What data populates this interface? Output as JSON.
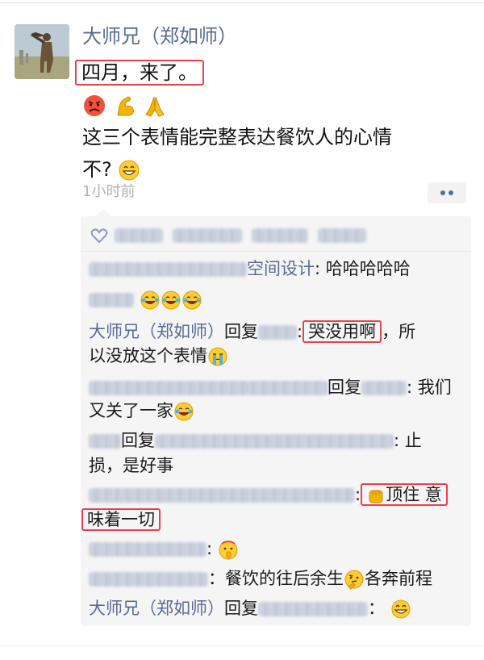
{
  "post": {
    "author": "大师兄（郑如师）",
    "text_line1": "四月，来了。",
    "text_line3": "这三个表情能完整表达餐饮人的心情",
    "text_line4": "不?",
    "time": "1小时前",
    "emojis": [
      "angry-face-icon",
      "flexed-biceps-icon",
      "folded-hands-icon"
    ]
  },
  "comments": [
    {
      "id": 1,
      "reply_to_name": "空间设计",
      "colon": ":",
      "text": "哈哈哈哈哈"
    },
    {
      "id": 2,
      "text": ""
    },
    {
      "id": 3,
      "author": "大师兄（郑如师）",
      "reply_word": "回复",
      "colon": ":",
      "text_hl": "哭没用啊",
      "text_rest": "，所",
      "text_line2": "以没放这个表情"
    },
    {
      "id": 4,
      "reply_word": "回复",
      "colon": ":",
      "text": "我们",
      "text_line2": "又关了一家"
    },
    {
      "id": 5,
      "reply_word": "回复",
      "colon": ":",
      "text": "止",
      "text_line2": "损，是好事"
    },
    {
      "id": 6,
      "colon": ":",
      "text_hl": "顶住 意",
      "text_line2_hl": "味着一切"
    },
    {
      "id": 7,
      "colon": ":"
    },
    {
      "id": 8,
      "colon": "：",
      "text": "餐饮的往后余生",
      "text_rest": "各奔前程"
    },
    {
      "id": 9,
      "author": "大师兄（郑如师）",
      "reply_word": "回复",
      "colon": "："
    }
  ],
  "colors": {
    "name_blue": "#576b95",
    "highlight_red": "#e8424a",
    "comment_bg": "#f5f5f5",
    "time_grey": "#b2b2b2"
  }
}
